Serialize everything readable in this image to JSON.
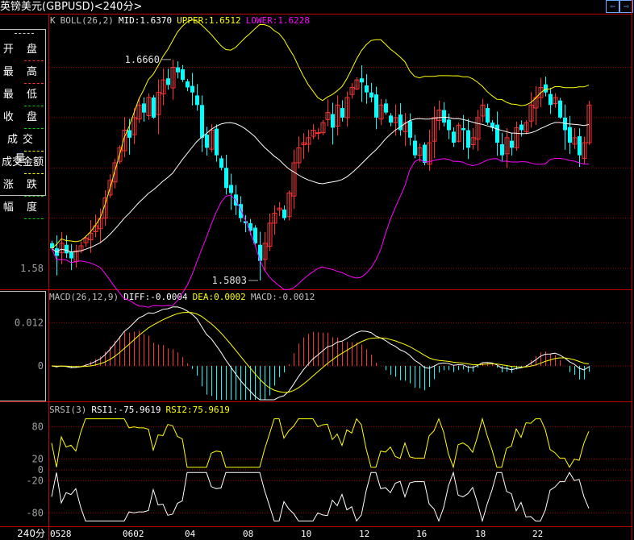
{
  "window": {
    "title": "英镑美元(GBPUSD)<240分>",
    "nav_prev": "⇦",
    "nav_next": "⇨"
  },
  "left_panel": {
    "items": [
      {
        "label": "开 盘",
        "color": "#ff3232"
      },
      {
        "label": "最 高",
        "color": "#ff3232"
      },
      {
        "label": "最 低",
        "color": "#00d000"
      },
      {
        "label": "收 盘",
        "color": "#00d000"
      },
      {
        "label": "成交量",
        "color": "#ffff00"
      },
      {
        "label": "成交金额",
        "color": "#ffff00"
      },
      {
        "label": "涨 跌",
        "color": "#00d000"
      },
      {
        "label": "幅 度",
        "color": "#00d000"
      }
    ]
  },
  "main_pane": {
    "prefix": "K",
    "name": "BOLL(26,2)",
    "mid": "MID:1.6370",
    "upper": "UPPER:1.6512",
    "lower": "LOWER:1.6228",
    "y_label": "1.58",
    "high_marker": "1.6660",
    "low_marker": "1.5803"
  },
  "macd_pane": {
    "name": "MACD(26,12,9)",
    "diff": "DIFF:-0.0004",
    "dea": "DEA:0.0002",
    "macd": "MACD:-0.0012",
    "y_labels": [
      "0.012",
      "0"
    ]
  },
  "rsi_pane": {
    "name": "SRSI(3)",
    "rsi1": "RSI1:-75.9619",
    "rsi2": "RSI2:75.9619",
    "y_labels": [
      "80",
      "20",
      "0",
      "-20",
      "-80"
    ]
  },
  "x_axis": {
    "period": "240分",
    "labels": [
      "0528",
      "0602",
      "04",
      "08",
      "10",
      "12",
      "16",
      "18",
      "22"
    ]
  },
  "colors": {
    "up": "#ff3232",
    "down": "#00ffff",
    "mid": "#ffffff",
    "upper": "#ffff00",
    "lower": "#ff00ff",
    "grid": "#a00000"
  },
  "chart_data": {
    "type": "candlestick",
    "price_ylim": [
      1.572,
      1.681
    ],
    "price_gridlines": [
      1.58,
      1.6,
      1.62,
      1.64,
      1.66
    ],
    "closes": [
      1.588,
      1.585,
      1.59,
      1.586,
      1.584,
      1.587,
      1.589,
      1.592,
      1.594,
      1.597,
      1.6,
      1.608,
      1.615,
      1.622,
      1.628,
      1.635,
      1.632,
      1.64,
      1.645,
      1.642,
      1.648,
      1.64,
      1.65,
      1.655,
      1.653,
      1.66,
      1.658,
      1.655,
      1.652,
      1.65,
      1.645,
      1.632,
      1.628,
      1.635,
      1.625,
      1.62,
      1.612,
      1.61,
      1.605,
      1.6,
      1.598,
      1.595,
      1.59,
      1.583,
      1.59,
      1.598,
      1.602,
      1.604,
      1.6,
      1.61,
      1.622,
      1.628,
      1.63,
      1.632,
      1.635,
      1.634,
      1.638,
      1.642,
      1.636,
      1.645,
      1.64,
      1.648,
      1.652,
      1.655,
      1.654,
      1.65,
      1.648,
      1.64,
      1.645,
      1.642,
      1.638,
      1.64,
      1.635,
      1.638,
      1.632,
      1.625,
      1.628,
      1.622,
      1.63,
      1.64,
      1.643,
      1.638,
      1.635,
      1.63,
      1.637,
      1.635,
      1.628,
      1.632,
      1.64,
      1.645,
      1.638,
      1.636,
      1.63,
      1.625,
      1.632,
      1.628,
      1.636,
      1.635,
      1.638,
      1.645,
      1.648,
      1.652,
      1.65,
      1.645,
      1.648,
      1.64,
      1.635,
      1.63,
      1.632,
      1.625,
      1.63,
      1.645
    ],
    "macd_ylim": [
      -0.0094,
      0.0206
    ],
    "rsi_levels": [
      80,
      20,
      0,
      -20,
      -80
    ]
  }
}
